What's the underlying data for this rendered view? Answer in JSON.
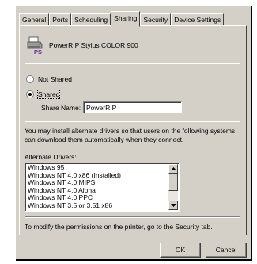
{
  "tabs": [
    {
      "label": "General"
    },
    {
      "label": "Ports"
    },
    {
      "label": "Scheduling"
    },
    {
      "label": "Sharing",
      "active": true
    },
    {
      "label": "Security"
    },
    {
      "label": "Device Settings"
    }
  ],
  "printer": {
    "name": "PowerRIP Stylus COLOR 900",
    "icon": "printer-share-icon",
    "icon_text": "PS"
  },
  "sharing": {
    "not_shared_label": "Not Shared",
    "shared_label": "Shared",
    "selected": "shared",
    "share_name_label": "Share Name:",
    "share_name_value": "PowerRIP"
  },
  "drivers": {
    "info_text": "You may install alternate drivers so that users on the following systems can download them automatically when they connect.",
    "label": "Alternate Drivers:",
    "items": [
      "Windows 95",
      "Windows NT 4.0 x86 (Installed)",
      "Windows NT 4.0 MIPS",
      "Windows NT 4.0 Alpha",
      "Windows NT 4.0 PPC",
      "Windows NT 3.5 or 3.51 x86"
    ]
  },
  "footer_text": "To modify the permissions on the printer, go to the Security tab.",
  "buttons": {
    "ok": "OK",
    "cancel": "Cancel"
  }
}
